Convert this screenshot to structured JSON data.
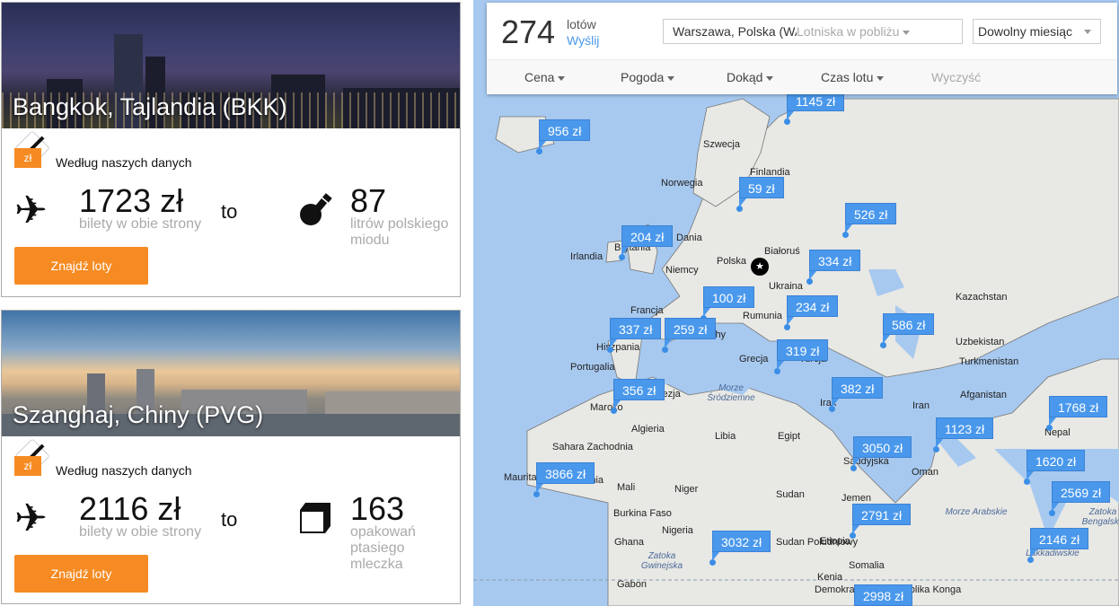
{
  "cards": [
    {
      "city": "Bangkok, Tajlandia (BKK)",
      "currency_tag": "zł",
      "source": "Według naszych danych",
      "price": "1723 zł",
      "price_sub": "bilety w obie strony",
      "to": "to",
      "count": "87",
      "count_sub": "litrów polskiego miodu",
      "count_icon": "honey-dipper-icon",
      "button": "Znajdź loty"
    },
    {
      "city": "Szanghaj, Chiny (PVG)",
      "currency_tag": "zł",
      "source": "Według naszych danych",
      "price": "2116 zł",
      "price_sub": "bilety w obie strony",
      "to": "to",
      "count": "163",
      "count_sub": "opakowań ptasiego mleczka",
      "count_icon": "candy-box-icon",
      "button": "Znajdź loty"
    }
  ],
  "panel": {
    "count": "274",
    "count_label": "lotów",
    "send": "Wyślij",
    "origin": "Warszawa, Polska (WAW)",
    "nearby": "Lotniska w pobliżu",
    "month": "Dowolny miesiąc",
    "filters": [
      "Cena",
      "Pogoda",
      "Dokąd",
      "Czas lotu"
    ],
    "clear": "Wyczyść"
  },
  "map": {
    "colors": {
      "sea": "#a7c9ef",
      "land": "#e8e8e4",
      "pin": "#4a98ec"
    },
    "countries": [
      "Szwecja",
      "Finlandia",
      "Norwegia",
      "Dania",
      "Brytania",
      "Irlandia",
      "Niemcy",
      "Polska",
      "Białoruś",
      "Ukraina",
      "Francja",
      "Rumunia",
      "Włochy",
      "Hiszpania",
      "Portugalia",
      "Grecja",
      "Turcja",
      "Maroko",
      "Tunezja",
      "Algieria",
      "Libia",
      "Egipt",
      "Irak",
      "Iran",
      "Kazachstan",
      "Uzbekistan",
      "Turkmenistan",
      "Afganistan",
      "Nepal",
      "Sahara Zachodnia",
      "Mauretania",
      "Mali",
      "Niger",
      "Nigeria",
      "Sudan",
      "Sudan Południowy",
      "Etiopia",
      "Somalia",
      "Kenia",
      "Jemen",
      "Oman",
      "Saudyjska",
      "Burkina Faso",
      "Ghana",
      "Gabon",
      "Demokratyczna Republika Konga",
      "Mauritania"
    ],
    "seas": [
      "Morze Śródziemne",
      "Morze Arabskie",
      "Zatoka Bengalska",
      "Zatoka Gwinejska",
      "Lakkadiwskie"
    ],
    "prices": [
      "1145 zł",
      "956 zł",
      "59 zł",
      "526 zł",
      "204 zł",
      "334 zł",
      "100 zł",
      "234 zł",
      "337 zł",
      "259 zł",
      "586 zł",
      "319 zł",
      "356 zł",
      "382 zł",
      "1768 zł",
      "1123 zł",
      "3050 zł",
      "1620 zł",
      "3866 zł",
      "2569 zł",
      "2791 zł",
      "3032 zł",
      "2146 zł",
      "2998 zł"
    ],
    "home_icon": "star-icon"
  }
}
